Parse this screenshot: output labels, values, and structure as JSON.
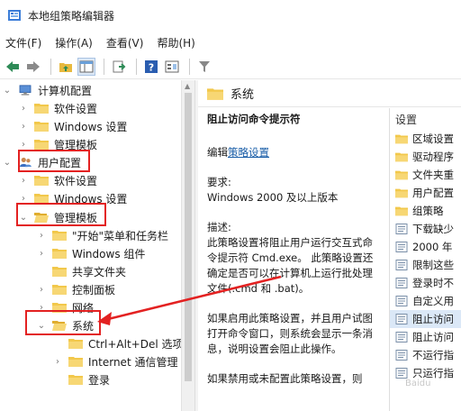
{
  "window": {
    "title": "本地组策略编辑器"
  },
  "menu": [
    "文件(F)",
    "操作(A)",
    "查看(V)",
    "帮助(H)"
  ],
  "tree": {
    "items": [
      {
        "label": "计算机配置",
        "level": 0,
        "state": "expanded",
        "icon": "computer-icon"
      },
      {
        "label": "软件设置",
        "level": 1,
        "state": "collapsed",
        "icon": "folder-icon"
      },
      {
        "label": "Windows 设置",
        "level": 1,
        "state": "collapsed",
        "icon": "folder-icon"
      },
      {
        "label": "管理模板",
        "level": 1,
        "state": "collapsed",
        "icon": "folder-icon"
      },
      {
        "label": "用户配置",
        "level": 0,
        "state": "expanded",
        "icon": "user-icon"
      },
      {
        "label": "软件设置",
        "level": 1,
        "state": "collapsed",
        "icon": "folder-icon"
      },
      {
        "label": "Windows 设置",
        "level": 1,
        "state": "collapsed",
        "icon": "folder-icon"
      },
      {
        "label": "管理模板",
        "level": 1,
        "state": "expanded",
        "icon": "folder-open-icon"
      },
      {
        "label": "\"开始\"菜单和任务栏",
        "level": 2,
        "state": "collapsed",
        "icon": "folder-icon"
      },
      {
        "label": "Windows 组件",
        "level": 2,
        "state": "collapsed",
        "icon": "folder-icon"
      },
      {
        "label": "共享文件夹",
        "level": 2,
        "state": "none",
        "icon": "folder-icon"
      },
      {
        "label": "控制面板",
        "level": 2,
        "state": "collapsed",
        "icon": "folder-icon"
      },
      {
        "label": "网络",
        "level": 2,
        "state": "collapsed",
        "icon": "folder-icon"
      },
      {
        "label": "系统",
        "level": 2,
        "state": "expanded",
        "icon": "folder-open-icon"
      },
      {
        "label": "Ctrl+Alt+Del 选项",
        "level": 3,
        "state": "none",
        "icon": "folder-icon"
      },
      {
        "label": "Internet 通信管理",
        "level": 3,
        "state": "collapsed",
        "icon": "folder-icon"
      },
      {
        "label": "登录",
        "level": 3,
        "state": "none",
        "icon": "folder-icon"
      }
    ]
  },
  "header": {
    "title": "系统"
  },
  "description": {
    "policy_title": "阻止访问命令提示符",
    "edit_prefix": "编辑",
    "edit_link": "策略设置",
    "requirement_label": "要求:",
    "requirement_value": "Windows 2000 及以上版本",
    "desc_label": "描述:",
    "desc_p1": "此策略设置将阻止用户运行交互式命令提示符 Cmd.exe。 此策略设置还确定是否可以在计算机上运行批处理文件(.cmd 和 .bat)。",
    "desc_p2": "如果启用此策略设置，并且用户试图打开命令窗口，则系统会显示一条消息，说明设置会阻止此操作。",
    "desc_p3": "如果禁用或未配置此策略设置，则"
  },
  "settings": {
    "header": "设置",
    "items": [
      {
        "label": "区域设置",
        "icon": "folder-icon"
      },
      {
        "label": "驱动程序",
        "icon": "folder-icon"
      },
      {
        "label": "文件夹重",
        "icon": "folder-icon"
      },
      {
        "label": "用户配置",
        "icon": "folder-icon"
      },
      {
        "label": "组策略",
        "icon": "folder-icon"
      },
      {
        "label": "下载缺少",
        "icon": "policy-icon"
      },
      {
        "label": "2000 年",
        "icon": "policy-icon"
      },
      {
        "label": "限制这些",
        "icon": "policy-icon"
      },
      {
        "label": "登录时不",
        "icon": "policy-icon"
      },
      {
        "label": "自定义用",
        "icon": "policy-icon"
      },
      {
        "label": "阻止访问",
        "icon": "policy-icon",
        "selected": true
      },
      {
        "label": "阻止访问",
        "icon": "policy-icon"
      },
      {
        "label": "不运行指",
        "icon": "policy-icon"
      },
      {
        "label": "只运行指",
        "icon": "policy-icon"
      }
    ]
  },
  "watermark": "Baidu"
}
